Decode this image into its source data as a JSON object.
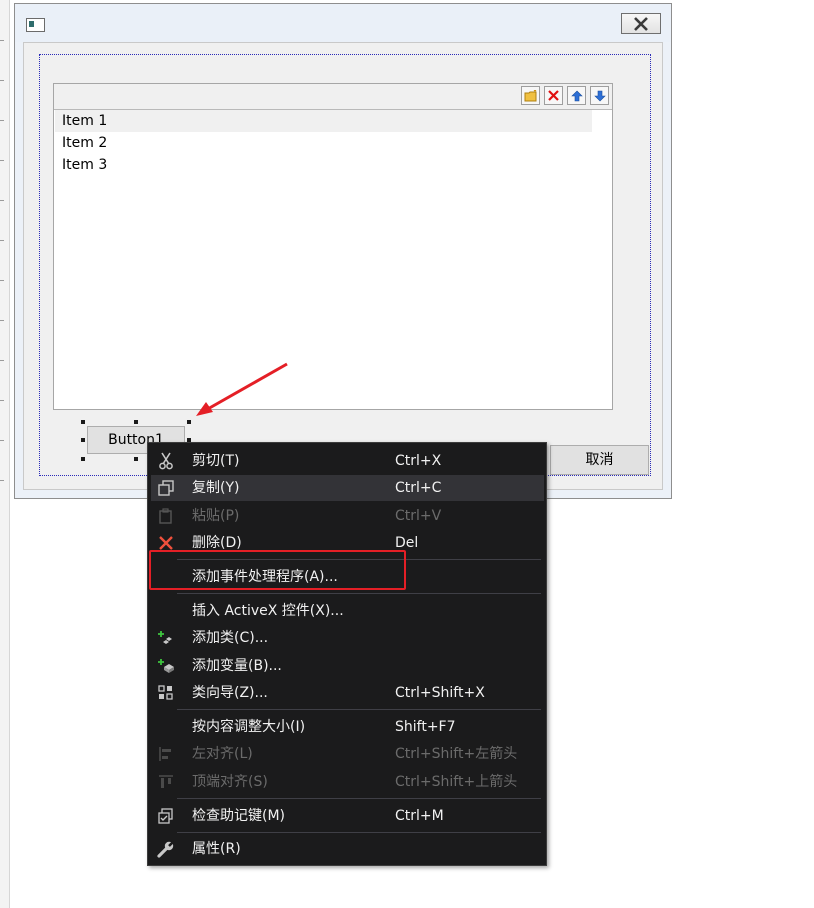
{
  "dialog": {
    "list": {
      "items": [
        "Item 1",
        "Item 2",
        "Item 3"
      ]
    },
    "toolbar": {
      "icons": [
        "folder-new-icon",
        "delete-x-icon",
        "move-up-icon",
        "move-down-icon"
      ]
    },
    "button1_label": "Button1",
    "cancel_label": "取消"
  },
  "context_menu": {
    "items": [
      {
        "icon": "scissors-icon",
        "label": "剪切(T)",
        "shortcut": "Ctrl+X",
        "enabled": true
      },
      {
        "icon": "copy-icon",
        "label": "复制(Y)",
        "shortcut": "Ctrl+C",
        "enabled": true,
        "highlighted": true
      },
      {
        "icon": "paste-icon",
        "label": "粘贴(P)",
        "shortcut": "Ctrl+V",
        "enabled": false
      },
      {
        "icon": "delete-icon",
        "label": "删除(D)",
        "shortcut": "Del",
        "enabled": true
      },
      {
        "icon": "",
        "label": "添加事件处理程序(A)...",
        "shortcut": "",
        "enabled": true
      },
      {
        "icon": "",
        "label": "插入 ActiveX 控件(X)...",
        "shortcut": "",
        "enabled": true
      },
      {
        "icon": "add-class-icon",
        "label": "添加类(C)...",
        "shortcut": "",
        "enabled": true
      },
      {
        "icon": "add-variable-icon",
        "label": "添加变量(B)...",
        "shortcut": "",
        "enabled": true
      },
      {
        "icon": "class-wizard-icon",
        "label": "类向导(Z)...",
        "shortcut": "Ctrl+Shift+X",
        "enabled": true
      },
      {
        "icon": "",
        "label": "按内容调整大小(I)",
        "shortcut": "Shift+F7",
        "enabled": true
      },
      {
        "icon": "align-left-icon",
        "label": "左对齐(L)",
        "shortcut": "Ctrl+Shift+左箭头",
        "enabled": false
      },
      {
        "icon": "align-top-icon",
        "label": "顶端对齐(S)",
        "shortcut": "Ctrl+Shift+上箭头",
        "enabled": false
      },
      {
        "icon": "check-mnemonics-icon",
        "label": "检查助记键(M)",
        "shortcut": "Ctrl+M",
        "enabled": true
      },
      {
        "icon": "wrench-icon",
        "label": "属性(R)",
        "shortcut": "",
        "enabled": true
      }
    ]
  },
  "colors": {
    "annotation_red": "#e41f26",
    "menu_bg": "#1b1b1c",
    "menu_highlight": "#333337"
  }
}
